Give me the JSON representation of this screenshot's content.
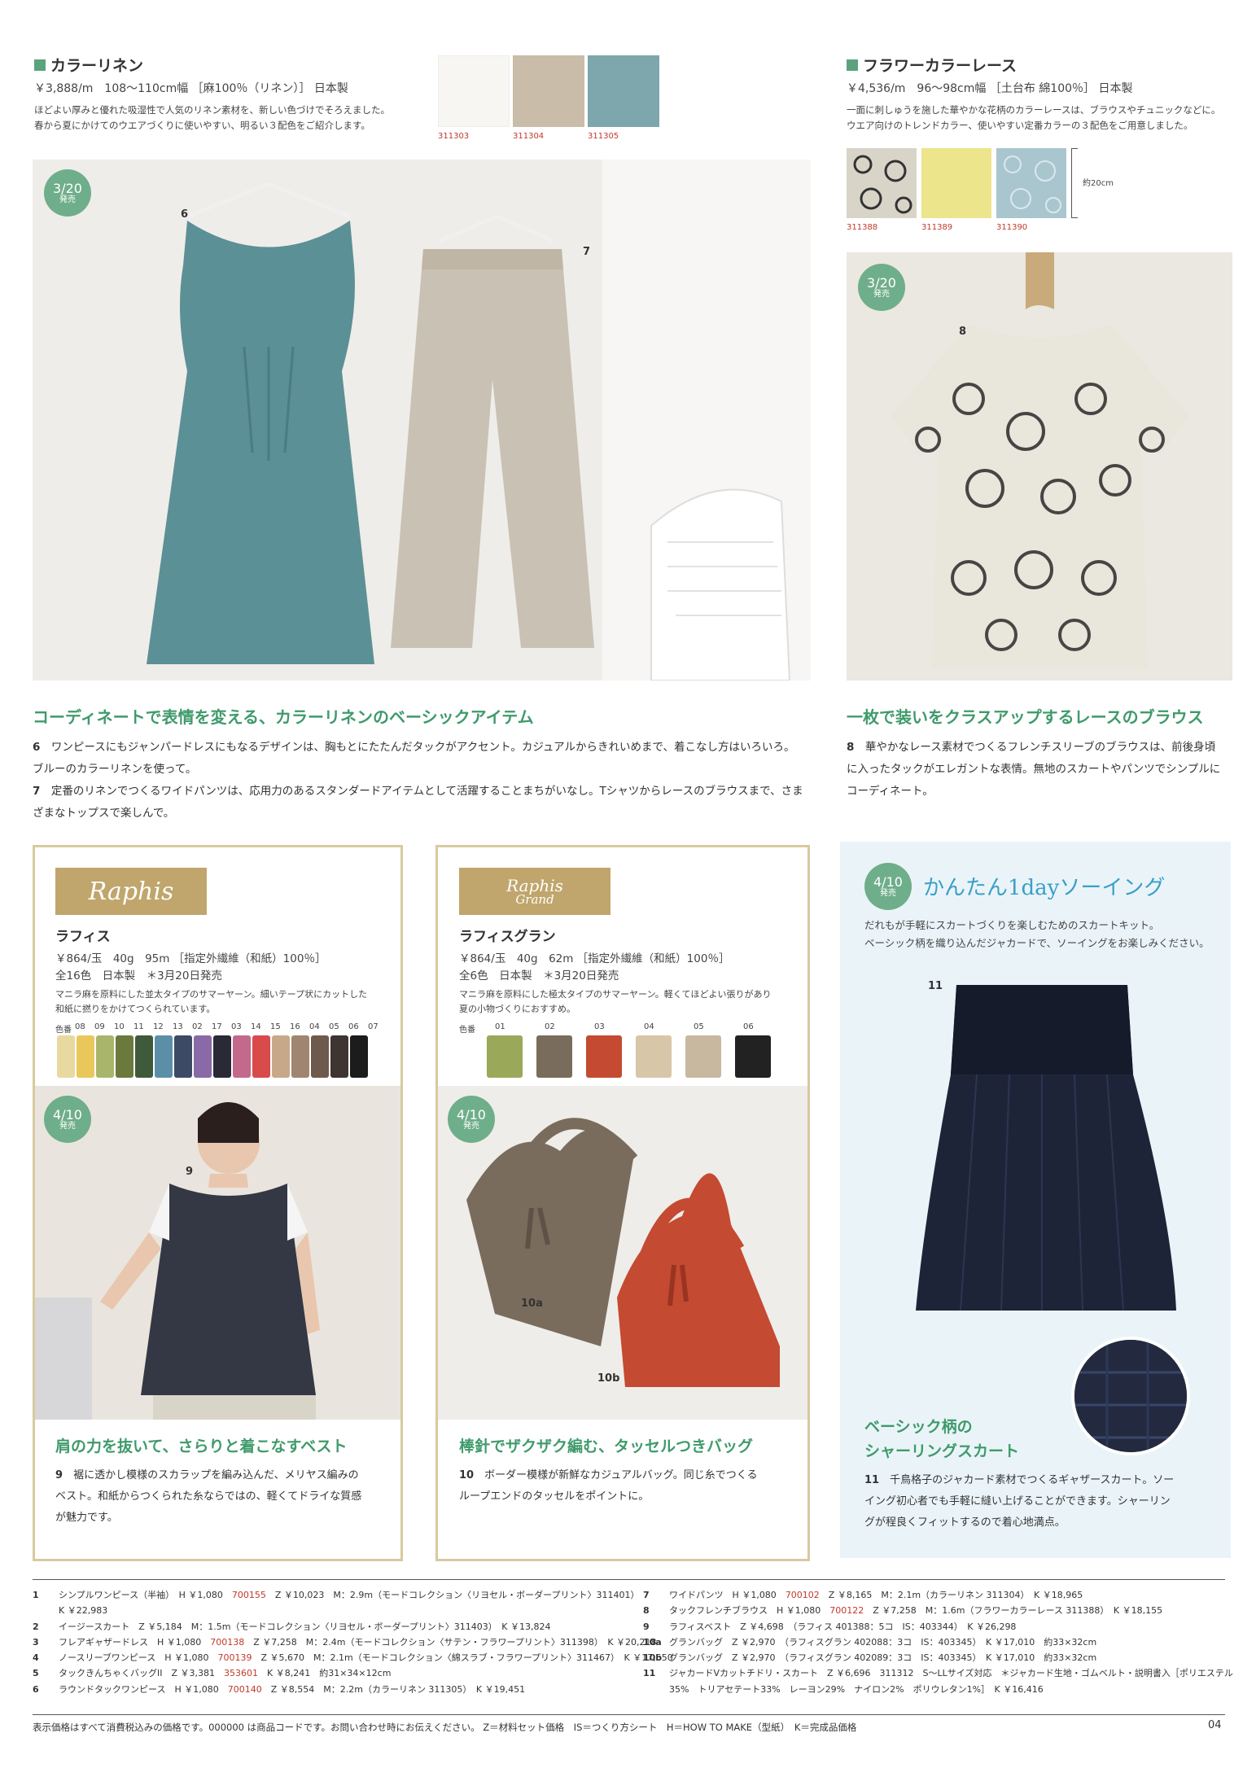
{
  "linen": {
    "title": "カラーリネン",
    "spec": "￥3,888/m　108～110cm幅 ［麻100％（リネン）］ 日本製",
    "desc1": "ほどよい厚みと優れた吸湿性で人気のリネン素材を、新しい色づけでそろえました。",
    "desc2": "春から夏にかけてのウエアづくりに使いやすい、明るい３配色をご紹介します。",
    "swatches": [
      {
        "code": "311303",
        "color": "#f7f6f2"
      },
      {
        "code": "311304",
        "color": "#c9bca8"
      },
      {
        "code": "311305",
        "color": "#7ea6ad"
      }
    ],
    "badge_date": "3/20",
    "badge_sub": "発売",
    "label6": "6",
    "label7": "7",
    "heading": "コーディネートで表情を変える、カラーリネンのベーシックアイテム",
    "p6_num": "6",
    "p6_a": "ワンピースにもジャンパードレスにもなるデザインは、胸もとにたたんだタックがアクセント。カジュアルからきれいめまで、着こなし方はいろいろ。",
    "p6_b": "ブルーのカラーリネンを使って。",
    "p7_num": "7",
    "p7_a": "定番のリネンでつくるワイドパンツは、応用力のあるスタンダードアイテムとして活躍することまちがいなし。Tシャツからレースのブラウスまで、さま",
    "p7_b": "ざまなトップスで楽しんで。"
  },
  "lace": {
    "title": "フラワーカラーレース",
    "spec": "￥4,536/m　96～98cm幅 ［土台布 綿100％］ 日本製",
    "desc1": "一面に刺しゅうを施した華やかな花柄のカラーレースは、ブラウスやチュニックなどに。",
    "desc2": "ウエア向けのトレンドカラー、使いやすい定番カラーの３配色をご用意しました。",
    "swatches": [
      {
        "code": "311388",
        "color": "#d8d4c8"
      },
      {
        "code": "311389",
        "color": "#ece58c"
      },
      {
        "code": "311390",
        "color": "#a9c6cf"
      }
    ],
    "size_note": "約20cm",
    "badge_date": "3/20",
    "badge_sub": "発売",
    "label8": "8",
    "heading": "一枚で装いをクラスアップするレースのブラウス",
    "p8_num": "8",
    "p8_a": "華やかなレース素材でつくるフレンチスリーブのブラウスは、前後身頃",
    "p8_b": "に入ったタックがエレガントな表情。無地のスカートやパンツでシンプルに",
    "p8_c": "コーディネート。"
  },
  "raphis": {
    "brand": "Raphis",
    "name": "ラフィス",
    "spec1": "￥864/玉　40g　95m ［指定外繊維（和紙）100％］",
    "spec2": "全16色　日本製　＊3月20日発売",
    "desc1": "マニラ麻を原料にした並太タイプのサマーヤーン。細いテープ状にカットした",
    "desc2": "和紙に撚りをかけてつくられています。",
    "color_label": "色番",
    "colors": [
      {
        "n": "08",
        "c": "#e8d9a0"
      },
      {
        "n": "09",
        "c": "#e9c75a"
      },
      {
        "n": "10",
        "c": "#a9b56a"
      },
      {
        "n": "11",
        "c": "#6b7a3c"
      },
      {
        "n": "12",
        "c": "#3f5a3a"
      },
      {
        "n": "13",
        "c": "#5b8fa8"
      },
      {
        "n": "02",
        "c": "#3c4a66"
      },
      {
        "n": "17",
        "c": "#8a6aa6"
      },
      {
        "n": "03",
        "c": "#2a2a36"
      },
      {
        "n": "14",
        "c": "#c2698c"
      },
      {
        "n": "15",
        "c": "#d94a4a"
      },
      {
        "n": "16",
        "c": "#c7a98a"
      },
      {
        "n": "04",
        "c": "#a08670"
      },
      {
        "n": "05",
        "c": "#6e5a4c"
      },
      {
        "n": "06",
        "c": "#3e3432"
      },
      {
        "n": "07",
        "c": "#1c1c1c"
      }
    ],
    "badge_date": "4/10",
    "badge_sub": "発売",
    "label9": "9",
    "heading": "肩の力を抜いて、さらりと着こなすベスト",
    "p9_num": "9",
    "p9_a": "裾に透かし模様のスカラップを編み込んだ、メリヤス編みの",
    "p9_b": "ベスト。和紙からつくられた糸ならではの、軽くてドライな質感",
    "p9_c": "が魅力です。"
  },
  "grand": {
    "brand1": "Raphis",
    "brand2": "Grand",
    "name": "ラフィスグラン",
    "spec1": "￥864/玉　40g　62m ［指定外繊維（和紙）100％］",
    "spec2": "全6色　日本製　＊3月20日発売",
    "desc1": "マニラ麻を原料にした極太タイプのサマーヤーン。軽くてほどよい張りがあり",
    "desc2": "夏の小物づくりにおすすめ。",
    "color_label": "色番",
    "colors": [
      {
        "n": "01",
        "c": "#9aa85a"
      },
      {
        "n": "02",
        "c": "#7a6c5c"
      },
      {
        "n": "03",
        "c": "#c44a32"
      },
      {
        "n": "04",
        "c": "#d8c6a8"
      },
      {
        "n": "05",
        "c": "#c8b8a0"
      },
      {
        "n": "06",
        "c": "#222222"
      }
    ],
    "badge_date": "4/10",
    "badge_sub": "発売",
    "label10a": "10a",
    "label10b": "10b",
    "heading": "棒針でザクザク編む、タッセルつきバッグ",
    "p10_num": "10",
    "p10_a": "ボーダー模様が新鮮なカジュアルバッグ。同じ糸でつくる",
    "p10_b": "ループエンドのタッセルをポイントに。"
  },
  "sewing": {
    "badge_date": "4/10",
    "badge_sub": "発売",
    "title": "かんたん1dayソーイング",
    "desc1": "だれもが手軽にスカートづくりを楽しむためのスカートキット。",
    "desc2": "ベーシック柄を織り込んだジャカードで、ソーイングをお楽しみください。",
    "label11": "11",
    "heading1": "ベーシック柄の",
    "heading2": "シャーリングスカート",
    "p11_num": "11",
    "p11_a": "千鳥格子のジャカード素材でつくるギャザースカート。ソー",
    "p11_b": "イング初心者でも手軽に縫い上げることができます。シャーリン",
    "p11_c": "グが程良くフィットするので着心地満点。"
  },
  "footer_left": [
    {
      "num": "1",
      "text_a": "シンプルワンピース（半袖）　H ￥1,080　",
      "code": "700155",
      "text_b": "　Z ￥10,023　M：2.9m（モードコレクション〈リヨセル・ボーダープリント〉311401）"
    },
    {
      "num": "",
      "text_a": "K ￥22,983",
      "code": "",
      "text_b": ""
    },
    {
      "num": "2",
      "text_a": "イージースカート　Z ￥5,184　M：1.5m（モードコレクション〈リヨセル・ボーダープリント〉311403）　K ￥13,824",
      "code": "",
      "text_b": ""
    },
    {
      "num": "3",
      "text_a": "フレアギャザードレス　H ￥1,080　",
      "code": "700138",
      "text_b": "　Z ￥7,258　M：2.4m（モードコレクション〈サテン・フラワープリント〉311398）　K ￥20,218"
    },
    {
      "num": "4",
      "text_a": "ノースリーブワンピース　H ￥1,080　",
      "code": "700139",
      "text_b": "　Z ￥5,670　M：2.1m（モードコレクション〈綿スラブ・フラワープリント〉311467）　K ￥17,550"
    },
    {
      "num": "5",
      "text_a": "タックきんちゃくバッグII　Z ￥3,381　",
      "code": "353601",
      "text_b": "　K ￥8,241　約31×34×12cm"
    },
    {
      "num": "6",
      "text_a": "ラウンドタックワンピース　H ￥1,080　",
      "code": "700140",
      "text_b": "　Z ￥8,554　M：2.2m（カラーリネン 311305）　K ￥19,451"
    }
  ],
  "footer_right": [
    {
      "num": "7",
      "text_a": "ワイドパンツ　H ￥1,080　",
      "code": "700102",
      "text_b": "　Z ￥8,165　M：2.1m（カラーリネン 311304）　K ￥18,965"
    },
    {
      "num": "8",
      "text_a": "タックフレンチブラウス　H ￥1,080　",
      "code": "700122",
      "text_b": "　Z ￥7,258　M：1.6m（フラワーカラーレース 311388）　K ￥18,155"
    },
    {
      "num": "9",
      "text_a": "ラフィスベスト　Z ￥4,698　（ラフィス 401388：5コ　IS：403344）　K ￥26,298",
      "code": "",
      "text_b": ""
    },
    {
      "num": "10a",
      "text_a": "グランバッグ　Z ￥2,970　（ラフィスグラン 402088：3コ　IS：403345）　K ￥17,010　約33×32cm",
      "code": "",
      "text_b": ""
    },
    {
      "num": "10b",
      "text_a": "グランバッグ　Z ￥2,970　（ラフィスグラン 402089：3コ　IS：403345）　K ￥17,010　約33×32cm",
      "code": "",
      "text_b": ""
    },
    {
      "num": "11",
      "text_a": "ジャカードVカットチドリ・スカート　Z ￥6,696　311312　S～LLサイズ対応　＊ジャカード生地・ゴムベルト・説明書入［ポリエステル",
      "code": "",
      "text_b": ""
    },
    {
      "num": "",
      "text_a": "35%　トリアセテート33%　レーヨン29%　ナイロン2%　ポリウレタン1%］　K ￥16,416",
      "code": "",
      "text_b": ""
    }
  ],
  "legend": "表示価格はすべて消費税込みの価格です。000000 は商品コードです。お問い合わせ時にお伝えください。 Z＝材料セット価格　IS＝つくり方シート　H＝HOW TO MAKE（型紙）　K＝完成品価格",
  "page_num": "04"
}
